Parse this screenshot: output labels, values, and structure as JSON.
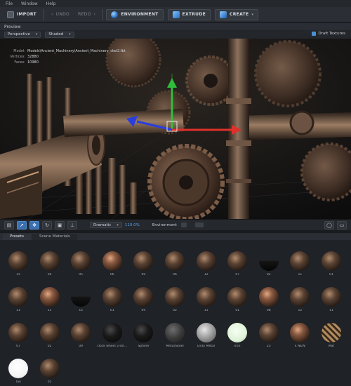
{
  "menu": [
    "File",
    "Window",
    "Help"
  ],
  "toolbar": {
    "import": "IMPORT",
    "undo": "UNDO",
    "redo": "REDO",
    "environment": "ENVIRONMENT",
    "extrude": "EXTRUDE",
    "create": "CREATE",
    "undo_arrow": "‹",
    "redo_arrow": "›",
    "create_chevron": "▾"
  },
  "preview": {
    "header": "Preview",
    "projection": "Perspective",
    "shading": "Shaded",
    "draft_textures": "Draft Textures",
    "model_label": "Model:",
    "model_value": "Models\\Ancient_Machinery\\Ancient_Machinery_skel2.fbt",
    "vertices_label": "Vertices:",
    "vertices_value": "32880",
    "faces_label": "Faces:",
    "faces_value": "10980"
  },
  "viewport_toolbar": {
    "lighting": "Dramatic",
    "exposure": "110.0%",
    "environment": "Environment"
  },
  "tabs": [
    "Presets",
    "Scene Materials"
  ],
  "materials": [
    {
      "label": "15",
      "style": "bronze"
    },
    {
      "label": "04",
      "style": "bronze"
    },
    {
      "label": "05",
      "style": "bronze"
    },
    {
      "label": "06",
      "style": "copper"
    },
    {
      "label": "09",
      "style": "bronze"
    },
    {
      "label": "06",
      "style": "bronze"
    },
    {
      "label": "12",
      "style": "bronze"
    },
    {
      "label": "07",
      "style": "bronze"
    },
    {
      "label": "02",
      "style": "dark-half"
    },
    {
      "label": "11",
      "style": "bronze"
    },
    {
      "label": "01",
      "style": "bronze"
    },
    {
      "label": "11",
      "style": "bronze"
    },
    {
      "label": "13",
      "style": "copper"
    },
    {
      "label": "15",
      "style": "dark-half"
    },
    {
      "label": "01",
      "style": "bronze"
    },
    {
      "label": "09",
      "style": "bronze"
    },
    {
      "label": "02",
      "style": "bronze"
    },
    {
      "label": "11",
      "style": "bronze"
    },
    {
      "label": "01",
      "style": "bronze"
    },
    {
      "label": "08",
      "style": "copper"
    },
    {
      "label": "12",
      "style": "bronze"
    },
    {
      "label": "11",
      "style": "bronze"
    },
    {
      "label": "07",
      "style": "bronze"
    },
    {
      "label": "02",
      "style": "bronze"
    },
    {
      "label": "09",
      "style": "bronze"
    },
    {
      "label": "clock wheel 3 sm...",
      "style": "black"
    },
    {
      "label": "Sphere",
      "style": "black"
    },
    {
      "label": "Metal/Steel",
      "style": "steel"
    },
    {
      "label": "Dirty Metal",
      "style": "silver"
    },
    {
      "label": "Iron",
      "style": "white-green"
    },
    {
      "label": "23",
      "style": "bronze"
    },
    {
      "label": "4 NEW",
      "style": "copper"
    },
    {
      "label": "Mat",
      "style": "pattern"
    },
    {
      "label": "Tan",
      "style": "white"
    },
    {
      "label": "05",
      "style": "bronze"
    }
  ],
  "colors": {
    "accent": "#3a6fb0",
    "axis_x": "#e0302a",
    "axis_y": "#2fbf3a",
    "axis_z": "#2a3ee0"
  },
  "icons": {
    "import": "import-icon",
    "environment": "environment-sphere-icon",
    "extrude": "extrude-icon",
    "create": "create-cube-icon"
  }
}
